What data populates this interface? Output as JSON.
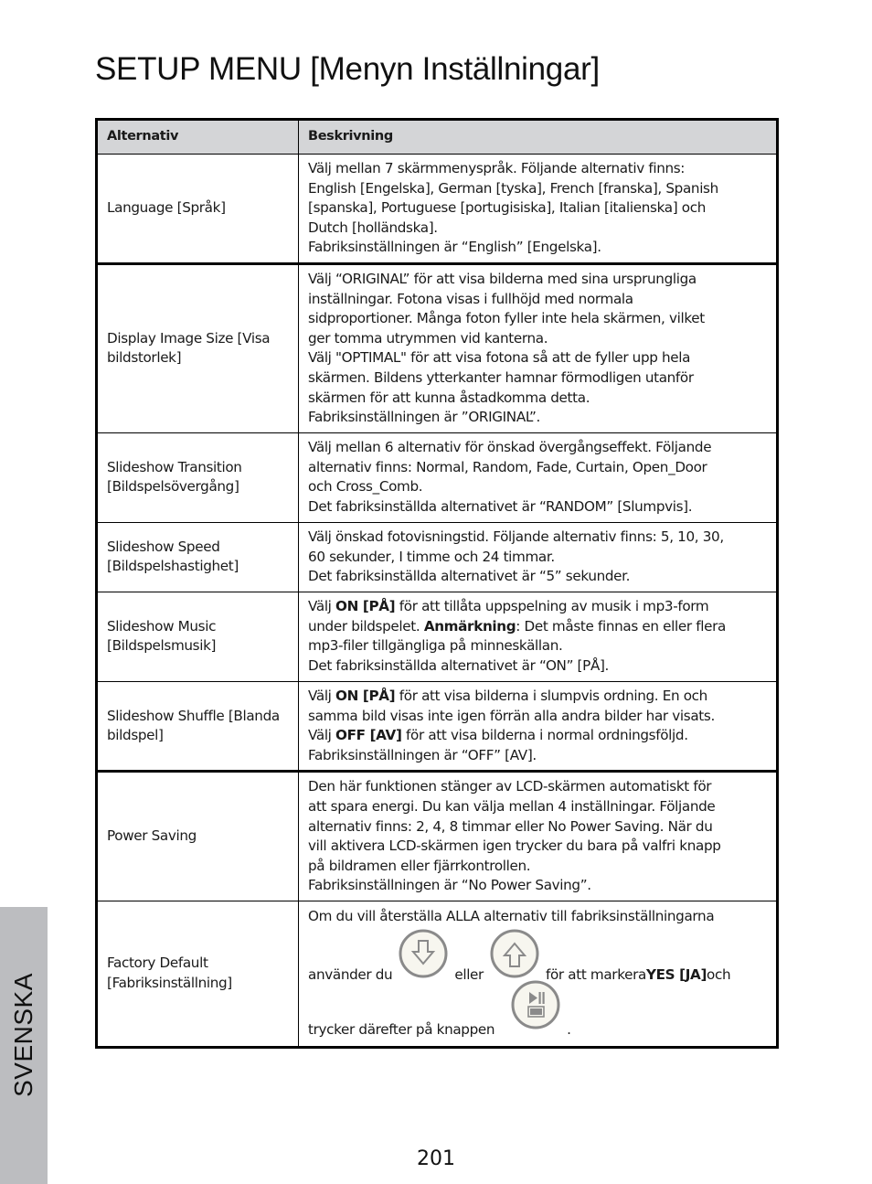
{
  "page": {
    "title": "SETUP MENU [Menyn Inställningar]",
    "page_number": "201",
    "side_tab": "SVENSKA"
  },
  "colors": {
    "header_bg": "#d4d5d7",
    "side_tab_bg": "#bcbdc0",
    "icon_stroke": "#8a8a8a",
    "icon_fill": "#f7f6ef"
  },
  "table": {
    "headers": [
      "Alternativ",
      "Beskrivning"
    ],
    "rows": [
      {
        "option": "Language [Språk]",
        "lines": [
          "Välj mellan 7 skärmmenyspråk. Följande alternativ finns:",
          "English [Engelska], German [tyska], French [franska], Spanish",
          "[spanska], Portuguese [portugisiska], Italian [italienska] och",
          "Dutch [holländska].",
          "Fabriksinställningen är “English” [Engelska]."
        ]
      },
      {
        "option": "Display Image Size [Visa bildstorlek]",
        "lines": [
          "Välj “ORIGINAL” för att visa bilderna med sina ursprungliga",
          "inställningar. Fotona visas i fullhöjd med normala",
          "sidproportioner. Många foton fyller inte hela skärmen, vilket",
          "ger tomma utrymmen vid kanterna.",
          "Välj \"OPTIMAL\" för att visa fotona så att de fyller upp hela",
          "skärmen. Bildens ytterkanter hamnar förmodligen utanför",
          "skärmen för att kunna åstadkomma detta.",
          "Fabriksinställningen är ”ORIGINAL”."
        ]
      },
      {
        "option": "Slideshow Transition [Bildspelsövergång]",
        "lines": [
          "Välj mellan 6 alternativ för önskad övergångseffekt. Följande",
          "alternativ finns: Normal, Random, Fade, Curtain, Open_Door",
          "och Cross_Comb.",
          "Det fabriksinställda alternativet är “RANDOM” [Slumpvis]."
        ]
      },
      {
        "option": "Slideshow Speed [Bildspelshastighet]",
        "lines": [
          "Välj önskad fotovisningstid. Följande alternativ finns: 5, 10, 30,",
          "60 sekunder, I timme och 24 timmar.",
          "Det fabriksinställda alternativet är “5” sekunder."
        ]
      },
      {
        "option": "Slideshow Music [Bildspelsmusik]",
        "l1_pre": "Välj ",
        "l1_bold": "ON [PÅ]",
        "l1_post": " för att tillåta uppspelning av musik i mp3-form",
        "l2_pre": "under bildspelet. ",
        "l2_bold": "Anmärkning",
        "l2_post": ": Det måste finnas en eller flera",
        "l3": "mp3-filer tillgängliga på minneskällan.",
        "l4": "Det fabriksinställda alternativet är “ON” [PÅ]."
      },
      {
        "option": "Slideshow Shuffle [Blanda bildspel]",
        "l1_pre": "Välj ",
        "l1_bold": "ON [PÅ]",
        "l1_post": " för att visa bilderna i slumpvis ordning. En och",
        "l2": "samma bild visas inte igen förrän alla andra bilder har visats.",
        "l3_pre": "Välj ",
        "l3_bold": "OFF [AV]",
        "l3_post": " för att visa bilderna i normal ordningsföljd.",
        "l4": "Fabriksinställningen är “OFF” [AV]."
      },
      {
        "option": "Power Saving",
        "lines": [
          "Den här funktionen stänger av LCD-skärmen automatiskt för",
          "att spara energi. Du kan välja mellan 4 inställningar. Följande",
          "alternativ finns: 2, 4, 8 timmar eller No Power Saving. När du",
          "vill aktivera LCD-skärmen igen trycker du bara på valfri knapp",
          "på bildramen eller fjärrkontrollen.",
          "Fabriksinställningen är “No Power Saving”."
        ]
      },
      {
        "option": "Factory Default [Fabriksinställning]",
        "l1": "Om du vill återställa ALLA alternativ till fabriksinställningarna",
        "l2_a": "använder du",
        "l2_b": "eller",
        "l2_c": "för att markera ",
        "l2_bold": "YES [JA]",
        "l2_d": " och",
        "l3_a": "trycker därefter på knappen",
        "l3_b": ".",
        "icons": [
          "down-arrow-button-icon",
          "up-arrow-button-icon",
          "play-pause-enter-button-icon"
        ]
      }
    ]
  }
}
